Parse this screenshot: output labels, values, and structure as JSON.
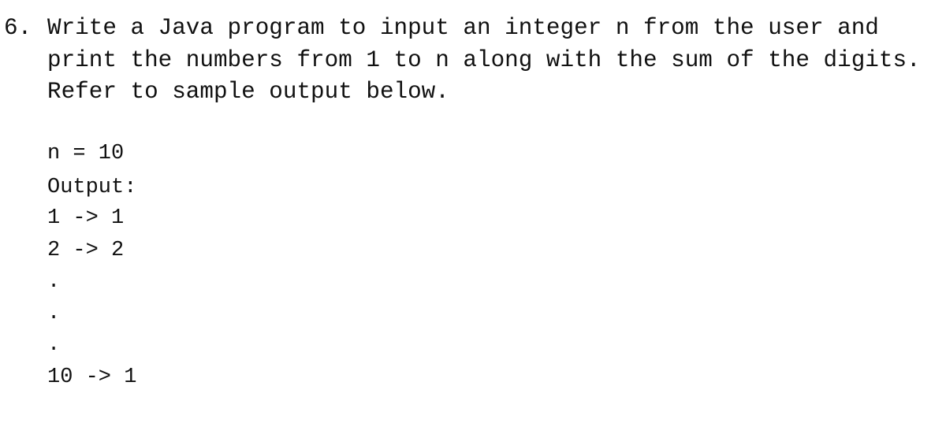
{
  "question": {
    "number": "6.",
    "lines": [
      "Write a Java program to input an integer n from the user and",
      "print the numbers from 1 to n along with the sum of the digits.",
      "Refer to sample output below."
    ]
  },
  "sample": {
    "input": "n = 10",
    "output_label": "Output:",
    "rows": [
      "1 -> 1",
      "2 -> 2",
      ".",
      ".",
      ".",
      "10 -> 1"
    ]
  }
}
